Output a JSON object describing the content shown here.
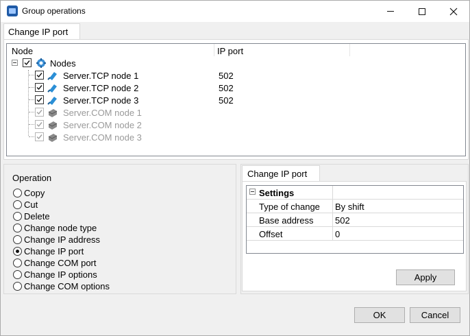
{
  "window": {
    "title": "Group operations",
    "controls": {
      "minimize": "minimize-icon",
      "maximize": "maximize-icon",
      "close": "close-icon"
    }
  },
  "top_tab": {
    "label": "Change IP port"
  },
  "tree": {
    "columns": [
      "Node",
      "IP port"
    ],
    "root": {
      "label": "Nodes",
      "checked": true,
      "icon": "nodes-icon"
    },
    "items": [
      {
        "label": "Server.TCP node 1",
        "port": "502",
        "checked": true,
        "enabled": true,
        "icon": "tcp-node-icon"
      },
      {
        "label": "Server.TCP node 2",
        "port": "502",
        "checked": true,
        "enabled": true,
        "icon": "tcp-node-icon"
      },
      {
        "label": "Server.TCP node 3",
        "port": "502",
        "checked": true,
        "enabled": true,
        "icon": "tcp-node-icon"
      },
      {
        "label": "Server.COM node 1",
        "port": "",
        "checked": true,
        "enabled": false,
        "icon": "com-node-icon"
      },
      {
        "label": "Server.COM node 2",
        "port": "",
        "checked": true,
        "enabled": false,
        "icon": "com-node-icon"
      },
      {
        "label": "Server.COM node 3",
        "port": "",
        "checked": true,
        "enabled": false,
        "icon": "com-node-icon"
      }
    ]
  },
  "operation": {
    "legend": "Operation",
    "selected": "Change IP port",
    "options": [
      "Copy",
      "Cut",
      "Delete",
      "Change node type",
      "Change IP address",
      "Change IP port",
      "Change COM port",
      "Change IP options",
      "Change COM options"
    ]
  },
  "right_tab": {
    "label": "Change IP port"
  },
  "settings": {
    "section": "Settings",
    "rows": [
      {
        "name": "Type of change",
        "value": "By shift"
      },
      {
        "name": "Base address",
        "value": "502"
      },
      {
        "name": "Offset",
        "value": "0"
      }
    ]
  },
  "buttons": {
    "apply": "Apply",
    "ok": "OK",
    "cancel": "Cancel"
  },
  "colors": {
    "disabled_text": "#9a9a9a",
    "button_face": "#e1e1e1",
    "tcp_icon": "#2b8fd6",
    "com_icon": "#8a8a8a"
  }
}
